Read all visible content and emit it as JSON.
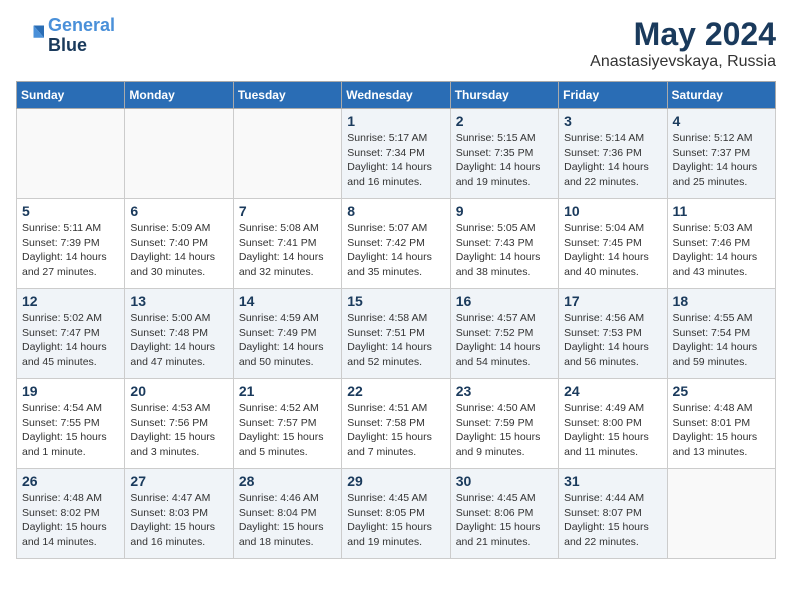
{
  "logo": {
    "line1": "General",
    "line2": "Blue"
  },
  "title": "May 2024",
  "subtitle": "Anastasiyevskaya, Russia",
  "header": {
    "days": [
      "Sunday",
      "Monday",
      "Tuesday",
      "Wednesday",
      "Thursday",
      "Friday",
      "Saturday"
    ]
  },
  "weeks": [
    {
      "cells": [
        {
          "day": "",
          "content": ""
        },
        {
          "day": "",
          "content": ""
        },
        {
          "day": "",
          "content": ""
        },
        {
          "day": "1",
          "content": "Sunrise: 5:17 AM\nSunset: 7:34 PM\nDaylight: 14 hours\nand 16 minutes."
        },
        {
          "day": "2",
          "content": "Sunrise: 5:15 AM\nSunset: 7:35 PM\nDaylight: 14 hours\nand 19 minutes."
        },
        {
          "day": "3",
          "content": "Sunrise: 5:14 AM\nSunset: 7:36 PM\nDaylight: 14 hours\nand 22 minutes."
        },
        {
          "day": "4",
          "content": "Sunrise: 5:12 AM\nSunset: 7:37 PM\nDaylight: 14 hours\nand 25 minutes."
        }
      ]
    },
    {
      "cells": [
        {
          "day": "5",
          "content": "Sunrise: 5:11 AM\nSunset: 7:39 PM\nDaylight: 14 hours\nand 27 minutes."
        },
        {
          "day": "6",
          "content": "Sunrise: 5:09 AM\nSunset: 7:40 PM\nDaylight: 14 hours\nand 30 minutes."
        },
        {
          "day": "7",
          "content": "Sunrise: 5:08 AM\nSunset: 7:41 PM\nDaylight: 14 hours\nand 32 minutes."
        },
        {
          "day": "8",
          "content": "Sunrise: 5:07 AM\nSunset: 7:42 PM\nDaylight: 14 hours\nand 35 minutes."
        },
        {
          "day": "9",
          "content": "Sunrise: 5:05 AM\nSunset: 7:43 PM\nDaylight: 14 hours\nand 38 minutes."
        },
        {
          "day": "10",
          "content": "Sunrise: 5:04 AM\nSunset: 7:45 PM\nDaylight: 14 hours\nand 40 minutes."
        },
        {
          "day": "11",
          "content": "Sunrise: 5:03 AM\nSunset: 7:46 PM\nDaylight: 14 hours\nand 43 minutes."
        }
      ]
    },
    {
      "cells": [
        {
          "day": "12",
          "content": "Sunrise: 5:02 AM\nSunset: 7:47 PM\nDaylight: 14 hours\nand 45 minutes."
        },
        {
          "day": "13",
          "content": "Sunrise: 5:00 AM\nSunset: 7:48 PM\nDaylight: 14 hours\nand 47 minutes."
        },
        {
          "day": "14",
          "content": "Sunrise: 4:59 AM\nSunset: 7:49 PM\nDaylight: 14 hours\nand 50 minutes."
        },
        {
          "day": "15",
          "content": "Sunrise: 4:58 AM\nSunset: 7:51 PM\nDaylight: 14 hours\nand 52 minutes."
        },
        {
          "day": "16",
          "content": "Sunrise: 4:57 AM\nSunset: 7:52 PM\nDaylight: 14 hours\nand 54 minutes."
        },
        {
          "day": "17",
          "content": "Sunrise: 4:56 AM\nSunset: 7:53 PM\nDaylight: 14 hours\nand 56 minutes."
        },
        {
          "day": "18",
          "content": "Sunrise: 4:55 AM\nSunset: 7:54 PM\nDaylight: 14 hours\nand 59 minutes."
        }
      ]
    },
    {
      "cells": [
        {
          "day": "19",
          "content": "Sunrise: 4:54 AM\nSunset: 7:55 PM\nDaylight: 15 hours\nand 1 minute."
        },
        {
          "day": "20",
          "content": "Sunrise: 4:53 AM\nSunset: 7:56 PM\nDaylight: 15 hours\nand 3 minutes."
        },
        {
          "day": "21",
          "content": "Sunrise: 4:52 AM\nSunset: 7:57 PM\nDaylight: 15 hours\nand 5 minutes."
        },
        {
          "day": "22",
          "content": "Sunrise: 4:51 AM\nSunset: 7:58 PM\nDaylight: 15 hours\nand 7 minutes."
        },
        {
          "day": "23",
          "content": "Sunrise: 4:50 AM\nSunset: 7:59 PM\nDaylight: 15 hours\nand 9 minutes."
        },
        {
          "day": "24",
          "content": "Sunrise: 4:49 AM\nSunset: 8:00 PM\nDaylight: 15 hours\nand 11 minutes."
        },
        {
          "day": "25",
          "content": "Sunrise: 4:48 AM\nSunset: 8:01 PM\nDaylight: 15 hours\nand 13 minutes."
        }
      ]
    },
    {
      "cells": [
        {
          "day": "26",
          "content": "Sunrise: 4:48 AM\nSunset: 8:02 PM\nDaylight: 15 hours\nand 14 minutes."
        },
        {
          "day": "27",
          "content": "Sunrise: 4:47 AM\nSunset: 8:03 PM\nDaylight: 15 hours\nand 16 minutes."
        },
        {
          "day": "28",
          "content": "Sunrise: 4:46 AM\nSunset: 8:04 PM\nDaylight: 15 hours\nand 18 minutes."
        },
        {
          "day": "29",
          "content": "Sunrise: 4:45 AM\nSunset: 8:05 PM\nDaylight: 15 hours\nand 19 minutes."
        },
        {
          "day": "30",
          "content": "Sunrise: 4:45 AM\nSunset: 8:06 PM\nDaylight: 15 hours\nand 21 minutes."
        },
        {
          "day": "31",
          "content": "Sunrise: 4:44 AM\nSunset: 8:07 PM\nDaylight: 15 hours\nand 22 minutes."
        },
        {
          "day": "",
          "content": ""
        }
      ]
    }
  ]
}
